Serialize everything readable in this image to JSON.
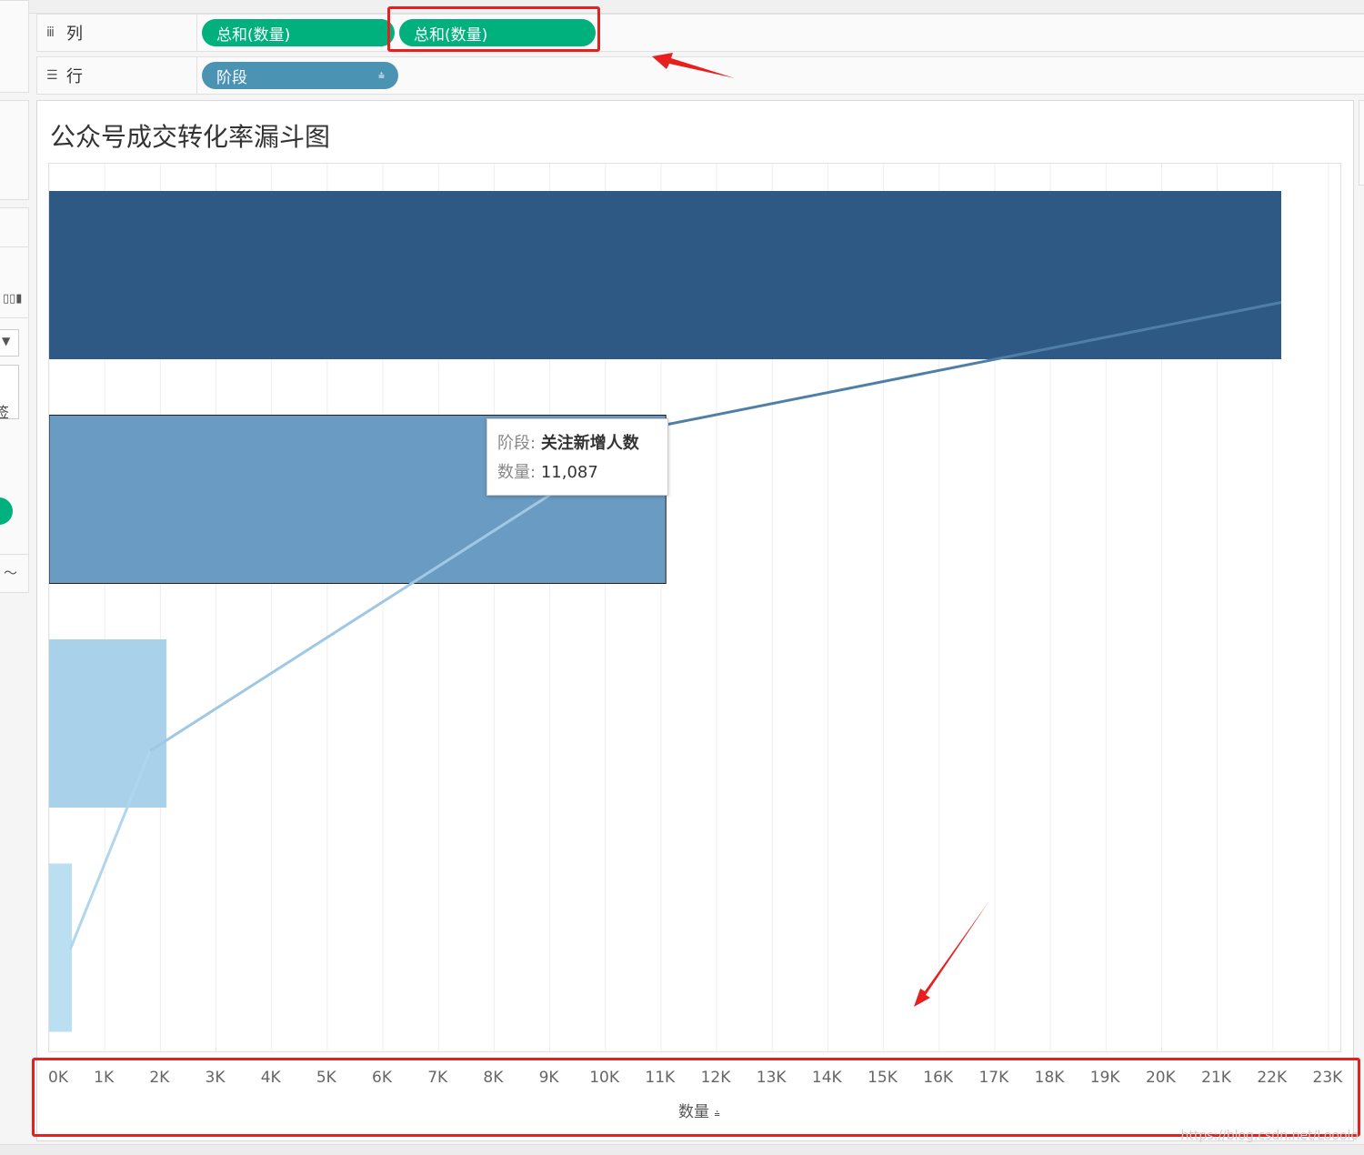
{
  "shelves": {
    "columns": {
      "label": "列",
      "icon": "columns-icon",
      "pills": [
        "总和(数量)",
        "总和(数量)"
      ]
    },
    "rows": {
      "label": "行",
      "icon": "rows-icon",
      "pills": [
        "阶段"
      ]
    }
  },
  "colors": {
    "pill_measure": "#00b17e",
    "pill_dimension": "#4a93b3",
    "annotation": "#e81f1f"
  },
  "left_panel": {
    "partial_text": "签"
  },
  "chart_data": {
    "type": "bar",
    "title": "公众号成交转化率漏斗图",
    "xlabel": "数量",
    "ylabel": "",
    "orientation": "horizontal",
    "categories": [
      "",
      "关注新增人数",
      "",
      ""
    ],
    "values": [
      22150,
      11087,
      2110,
      410
    ],
    "bar_colors": [
      "#2e5984",
      "#6a9bc3",
      "#a9d1ea",
      "#b9dff1"
    ],
    "xlim": [
      0,
      23000
    ],
    "x_ticks": [
      "0K",
      "1K",
      "2K",
      "3K",
      "4K",
      "5K",
      "6K",
      "7K",
      "8K",
      "9K",
      "10K",
      "11K",
      "12K",
      "13K",
      "14K",
      "15K",
      "16K",
      "17K",
      "18K",
      "19K",
      "20K",
      "21K",
      "22K",
      "23K"
    ],
    "grid": true,
    "legend": "none"
  },
  "tooltip": {
    "stage_key": "阶段:",
    "stage_value": "关注新增人数",
    "count_key": "数量:",
    "count_value": "11,087"
  },
  "watermark": "https://blog.csdn.net/Looolo"
}
